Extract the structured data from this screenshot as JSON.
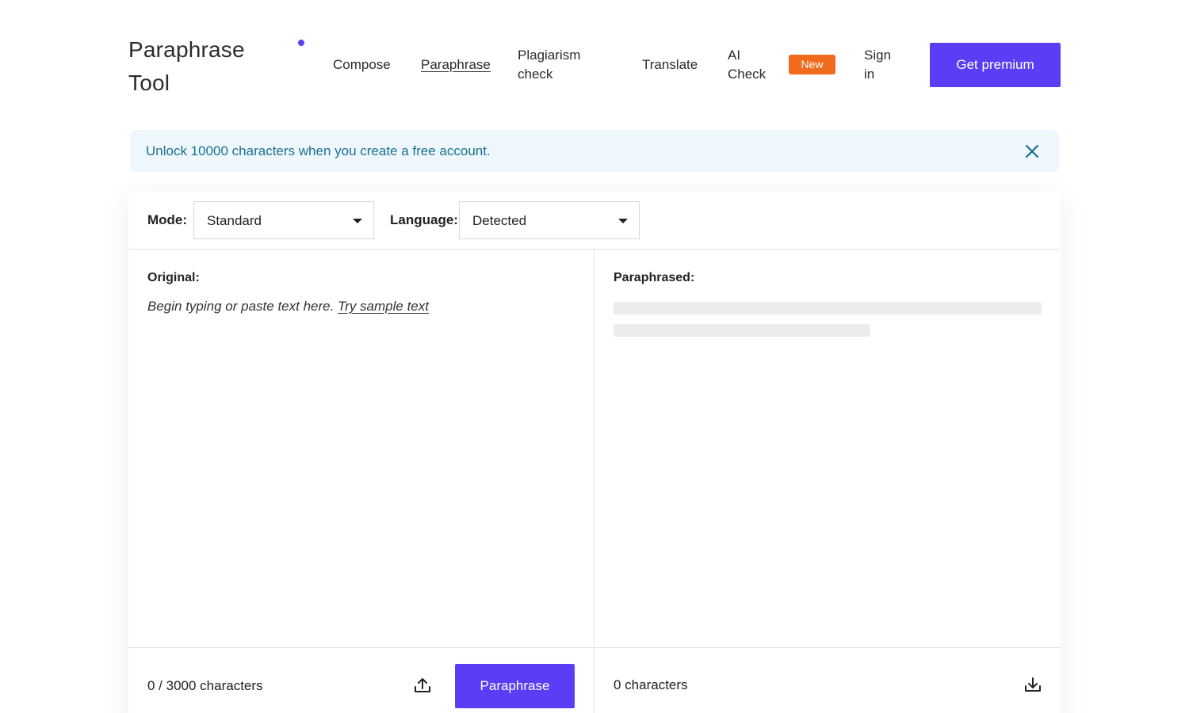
{
  "header": {
    "logo": "Paraphrase Tool",
    "nav": [
      {
        "label": "Compose"
      },
      {
        "label": "Paraphrase"
      },
      {
        "label": "Plagiarism check"
      },
      {
        "label": "Translate"
      },
      {
        "label": "AI Check"
      },
      {
        "label": "Sign in"
      }
    ],
    "badge": "New",
    "premium_label": "Get premium"
  },
  "banner": {
    "text": "Unlock 10000 characters when you create a free account."
  },
  "toolbar": {
    "mode_label": "Mode:",
    "mode_value": "Standard",
    "language_label": "Language:",
    "language_value": "Detected"
  },
  "original": {
    "label": "Original:",
    "placeholder": "Begin typing or paste text here.",
    "sample_link": "Try sample text",
    "char_count": "0 / 3000 characters",
    "paraphrase_button": "Paraphrase"
  },
  "paraphrased": {
    "label": "Paraphrased:",
    "char_count": "0 characters"
  },
  "colors": {
    "accent": "#5b3df5",
    "badge": "#f06b1c",
    "banner_bg": "#eef8fc",
    "banner_text": "#1a6f8f"
  },
  "icons": [
    "close-icon",
    "caret-down-icon",
    "upload-icon",
    "download-icon"
  ]
}
